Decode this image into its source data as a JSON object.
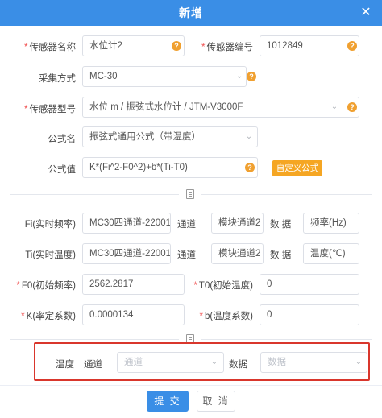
{
  "dialog": {
    "title": "新增"
  },
  "form": {
    "sensor_name": {
      "label": "传感器名称",
      "value": "水位计2"
    },
    "sensor_code": {
      "label": "传感器编号",
      "value": "1012849"
    },
    "collect_method": {
      "label": "采集方式",
      "value": "MC-30"
    },
    "sensor_model": {
      "label": "传感器型号",
      "value": "水位 m / 振弦式水位计 / JTM-V3000F"
    },
    "formula_name": {
      "label": "公式名",
      "value": "振弦式通用公式（带温度）"
    },
    "formula_value": {
      "label": "公式值",
      "value": "K*(Fi^2-F0^2)+b*(Ti-T0)",
      "custom_button": "自定义公式"
    },
    "fi_row": {
      "label": "Fi(实时频率)",
      "channel_select": "MC30四通道-22001",
      "channel_label": "通道",
      "channel_value": "模块通道2",
      "data_label": "数 据",
      "data_value": "频率(Hz)"
    },
    "ti_row": {
      "label": "Ti(实时温度)",
      "channel_select": "MC30四通道-22001",
      "channel_label": "通道",
      "channel_value": "模块通道2",
      "data_label": "数 据",
      "data_value": "温度(℃)"
    },
    "f0": {
      "label": "F0(初始频率)",
      "value": "2562.2817"
    },
    "t0": {
      "label": "T0(初始温度)",
      "value": "0"
    },
    "k": {
      "label": "K(率定系数)",
      "value": "0.0000134"
    },
    "b": {
      "label": "b(温度系数)",
      "value": "0"
    },
    "temperature_row": {
      "label": "温度",
      "channel_label": "通道",
      "channel_placeholder": "通道",
      "data_label": "数据",
      "data_placeholder": "数据"
    }
  },
  "footer": {
    "submit": "提 交",
    "cancel": "取 消"
  },
  "colors": {
    "primary": "#3a8ee6",
    "warning": "#f5a623",
    "highlight": "#d9362c",
    "required": "#f05050"
  },
  "icons": {
    "help": "question-circle-icon",
    "select": "chevron-down-icon",
    "doc": "document-icon",
    "close": "close-icon"
  }
}
